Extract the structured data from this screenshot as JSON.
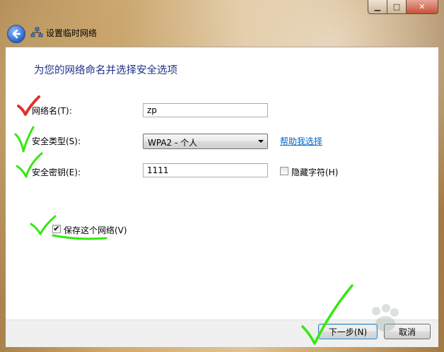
{
  "window": {
    "title": "设置临时网络",
    "controls": [
      "minimize",
      "maximize",
      "close"
    ]
  },
  "heading": "为您的网络命名并选择安全选项",
  "form": {
    "network_name_label": "网络名(T):",
    "network_name_value": "zp",
    "security_type_label": "安全类型(S):",
    "security_type_value": "WPA2 - 个人",
    "help_link": "帮助我选择",
    "security_key_label": "安全密钥(E):",
    "security_key_value": "1111",
    "hide_chars_label": "隐藏字符(H)",
    "hide_chars_checked": false,
    "save_network_label": "保存这个网络(V)",
    "save_network_checked": true
  },
  "footer": {
    "next_label": "下一步(N)",
    "cancel_label": "取消"
  },
  "colors": {
    "heading": "#1e3287",
    "link": "#0066cc",
    "check_red": "#e0302a",
    "check_green": "#35e80f"
  },
  "icons": [
    "back-arrow-icon",
    "network-icon",
    "checkmark-icon",
    "dropdown-arrow-icon"
  ]
}
